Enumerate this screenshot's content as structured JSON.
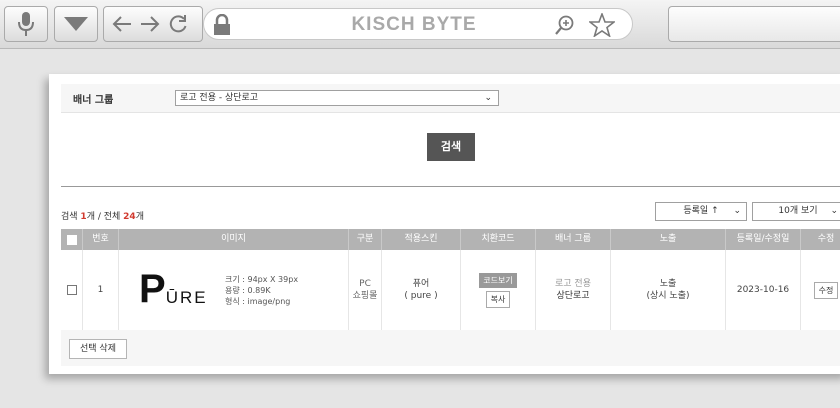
{
  "browser": {
    "title": "KISCH BYTE",
    "icons": [
      "microphone-icon",
      "dropdown-arrow-icon",
      "back-arrow-icon",
      "forward-arrow-icon",
      "reload-icon",
      "lock-icon",
      "zoom-icon",
      "star-icon"
    ]
  },
  "filter": {
    "group_label": "배너 그룹",
    "group_value": "로고 전용 - 상단로고",
    "search_label": "검색"
  },
  "results": {
    "prefix": "검색 ",
    "count": "1",
    "middle": "개 / 전체 ",
    "total": "24",
    "suffix": "개",
    "sort_value": "등록일 ↑",
    "page_size_value": "10개 보기"
  },
  "table": {
    "headers": [
      "번호",
      "이미지",
      "구분",
      "적용스킨",
      "치환코드",
      "배너 그룹",
      "노출",
      "등록일/수정일",
      "수정"
    ],
    "rows": [
      {
        "number": "1",
        "logo_text": "PŪRE",
        "size": "크기 : 94px X 39px",
        "capacity": "용량 : 0.89K",
        "format": "형식 : image/png",
        "type_line1": "PC",
        "type_line2": "쇼핑몰",
        "skin_line1": "퓨어",
        "skin_line2": "( pure )",
        "code_view": "코드보기",
        "copy": "복사",
        "group_line1": "로고 전용",
        "group_line2": "상단로고",
        "exposure_line1": "노출",
        "exposure_line2": "(상시 노출)",
        "date": "2023-10-16",
        "edit": "수정"
      }
    ]
  },
  "footer": {
    "delete_selected": "선택 삭제"
  },
  "colors": {
    "accent_red": "#d13a2f",
    "table_header": "#b3b3b3",
    "search_button": "#555555"
  }
}
